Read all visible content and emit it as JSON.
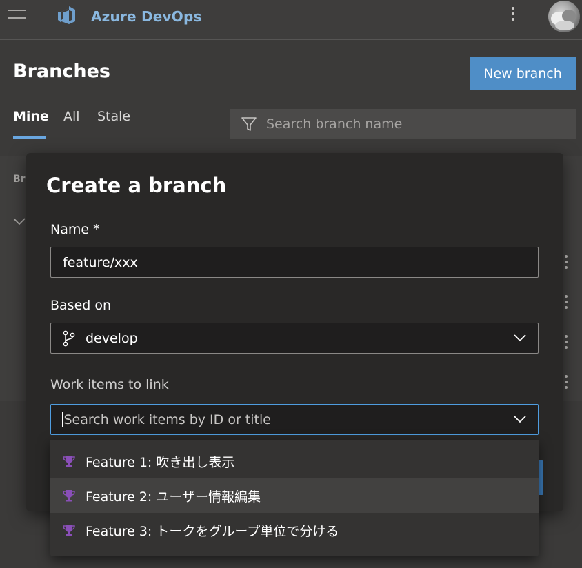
{
  "header": {
    "brand": "Azure DevOps",
    "icons": [
      "hamburger-icon",
      "azure-devops-logo-icon",
      "more-vertical-icon",
      "avatar"
    ]
  },
  "page": {
    "title": "Branches",
    "new_branch_label": "New branch",
    "tabs": [
      {
        "label": "Mine",
        "selected": true
      },
      {
        "label": "All",
        "selected": false
      },
      {
        "label": "Stale",
        "selected": false
      }
    ],
    "search_placeholder": "Search branch name",
    "column_header_partial": "Br"
  },
  "dialog": {
    "title": "Create a branch",
    "name_label": "Name *",
    "name_value": "feature/xxx",
    "based_on_label": "Based on",
    "based_on_value": "develop",
    "work_items_label": "Work items to link",
    "work_items_placeholder": "Search work items by ID or title"
  },
  "suggestions": [
    {
      "label": "Feature 1: 吹き出し表示",
      "icon": "trophy-icon"
    },
    {
      "label": "Feature 2: ユーザー情報編集",
      "icon": "trophy-icon",
      "hover": true
    },
    {
      "label": "Feature 3: トークをグループ単位で分ける",
      "icon": "trophy-icon"
    }
  ],
  "colors": {
    "accent": "#4f8ec7",
    "focus_border": "#4f9de0",
    "trophy": "#8a4fb8"
  }
}
